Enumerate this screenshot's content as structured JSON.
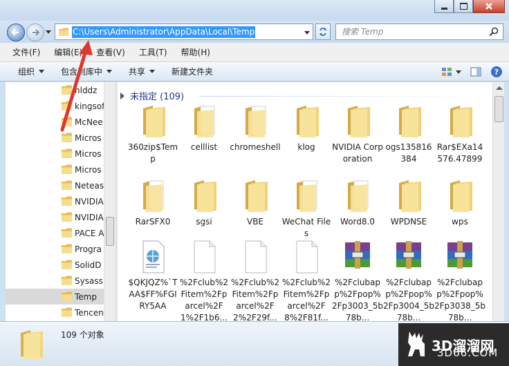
{
  "window": {
    "colors": {
      "accent": "#3399ff",
      "folder": "#f3d77f",
      "arrow": "#e0362c"
    }
  },
  "address": {
    "path": "C:\\Users\\Administrator\\AppData\\Local\\Temp",
    "search_placeholder": "搜索 Temp"
  },
  "menu": {
    "items": [
      "文件(F)",
      "编辑(E)",
      "查看(V)",
      "工具(T)",
      "帮助(H)"
    ]
  },
  "toolbar": {
    "organize": "组织",
    "include_in_library": "包含到库中",
    "share": "共享",
    "new_folder": "新建文件夹"
  },
  "navpane": {
    "items": [
      {
        "label": "hlddz",
        "icon": "folder-icon"
      },
      {
        "label": "kingsof",
        "icon": "folder-icon"
      },
      {
        "label": "McNee",
        "icon": "folder-icon"
      },
      {
        "label": "Micros",
        "icon": "folder-icon"
      },
      {
        "label": "Micros",
        "icon": "folder-icon"
      },
      {
        "label": "Micros",
        "icon": "folder-icon"
      },
      {
        "label": "Neteas",
        "icon": "folder-icon"
      },
      {
        "label": "NVIDIA",
        "icon": "folder-icon"
      },
      {
        "label": "NVIDIA",
        "icon": "folder-icon"
      },
      {
        "label": "PACE A",
        "icon": "folder-icon"
      },
      {
        "label": "Progra",
        "icon": "folder-icon"
      },
      {
        "label": "SolidD",
        "icon": "folder-icon"
      },
      {
        "label": "Sysassi",
        "icon": "folder-icon"
      },
      {
        "label": "Temp",
        "icon": "folder-icon",
        "selected": true
      },
      {
        "label": "Tencen",
        "icon": "folder-icon"
      }
    ]
  },
  "content": {
    "group_header": "未指定 (109)",
    "items": [
      {
        "name": "360zip$Temp",
        "type": "folder"
      },
      {
        "name": "celllist",
        "type": "folder-paper"
      },
      {
        "name": "chromeshell",
        "type": "folder-paper"
      },
      {
        "name": "klog",
        "type": "folder"
      },
      {
        "name": "NVIDIA Corporation",
        "type": "folder"
      },
      {
        "name": "ogs135816384",
        "type": "folder"
      },
      {
        "name": "Rar$EXa14576.47899",
        "type": "folder"
      },
      {
        "name": "RarSFX0",
        "type": "folder-paper"
      },
      {
        "name": "sgsi",
        "type": "folder"
      },
      {
        "name": "VBE",
        "type": "folder"
      },
      {
        "name": "WeChat Files",
        "type": "folder-paper"
      },
      {
        "name": "Word8.0",
        "type": "folder-paper"
      },
      {
        "name": "WPDNSE",
        "type": "folder"
      },
      {
        "name": "wps",
        "type": "folder"
      },
      {
        "name": "$QKJQZ%`TAA$FF%FGIRY5AA",
        "type": "web-file"
      },
      {
        "name": "%2Fclub%2Fitem%2Fparcel%2F1%2F1b6...",
        "type": "blank-file"
      },
      {
        "name": "%2Fclub%2Fitem%2Fparcel%2F2%2F29f...",
        "type": "blank-file"
      },
      {
        "name": "%2Fclub%2Fitem%2Fparcel%2F8%2F81f...",
        "type": "blank-file"
      },
      {
        "name": "%2Fclubapp%2Fpop%2Fp3003_5b78b...",
        "type": "rar-file"
      },
      {
        "name": "%2Fclubapp%2Fpop%2Fp3004_5b78b...",
        "type": "rar-file"
      },
      {
        "name": "%2Fclubapp%2Fpop%2Fp3038_5b78b...",
        "type": "rar-file"
      }
    ]
  },
  "status": {
    "count": "109 个对象"
  },
  "watermark": {
    "line1": "3D溜溜网",
    "line2": "3D66.COM"
  }
}
